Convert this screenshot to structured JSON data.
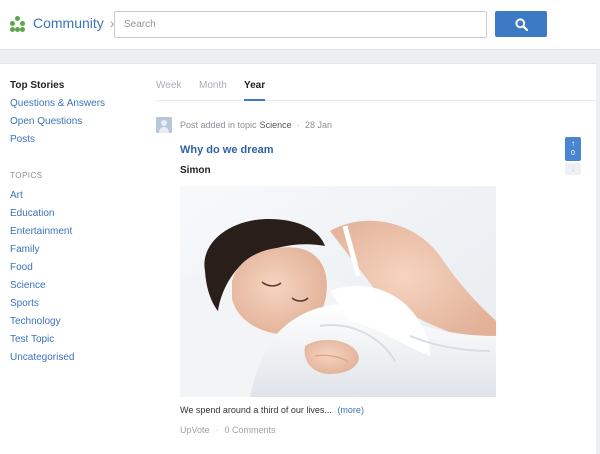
{
  "header": {
    "brand": "Community",
    "brand_chevron": "›",
    "search_placeholder": "Search",
    "search_icon": "search-icon",
    "accent_color": "#3d7ac6",
    "logo_color": "#5aa64a"
  },
  "sidebar": {
    "heading": "Top Stories",
    "links": [
      "Questions & Answers",
      "Open Questions",
      "Posts"
    ],
    "topics_label": "TOPICS",
    "topics": [
      "Art",
      "Education",
      "Entertainment",
      "Family",
      "Food",
      "Science",
      "Sports",
      "Technology",
      "Test Topic",
      "Uncategorised"
    ]
  },
  "tabs": [
    {
      "label": "Week",
      "active": false
    },
    {
      "label": "Month",
      "active": false
    },
    {
      "label": "Year",
      "active": true
    }
  ],
  "post": {
    "meta_prefix": "Post added in topic",
    "topic": "Science",
    "separator": "·",
    "date": "28 Jan",
    "title": "Why do we dream",
    "author": "Simon",
    "excerpt": "We spend around a third of our lives...",
    "more_label": "(more)",
    "upvote_label": "UpVote",
    "comments_label": "0 Comments",
    "vote_count": "0",
    "vote_up_glyph": "↑",
    "vote_down_glyph": "↓"
  }
}
